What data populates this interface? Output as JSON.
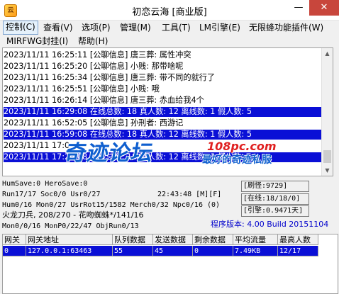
{
  "window": {
    "title": "初恋云海 [商业版]",
    "minimize": "—",
    "close": "✕"
  },
  "menu": {
    "row1": [
      "控制(C)",
      "查看(V)",
      "选项(P)",
      "管理(M)",
      "工具(T)",
      "LM引擎(E)",
      "无限蜂功能插件(W)"
    ],
    "row2": [
      "MIRFWG封挂(I)",
      "帮助(H)"
    ]
  },
  "log": [
    {
      "text": "2023/11/11 16:25:11 [公聊信息] 唐三葬: 属性冲突",
      "selected": false
    },
    {
      "text": "2023/11/11 16:25:20 [公聊信息] 小贱: 那带啥呢",
      "selected": false
    },
    {
      "text": "2023/11/11 16:25:34 [公聊信息] 唐三葬: 带不同的就行了",
      "selected": false
    },
    {
      "text": "2023/11/11 16:25:51 [公聊信息] 小贱: 哦",
      "selected": false
    },
    {
      "text": "2023/11/11 16:26:14 [公聊信息] 唐三葬: 赤血给我4个",
      "selected": false
    },
    {
      "text": "2023/11/11 16:29:08 在线总数: 18 真人数: 12 离线数: 1 假人数: 5",
      "selected": true
    },
    {
      "text": "2023/11/11 16:52:05 [公聊信息] 孙刑者: 西游记",
      "selected": false
    },
    {
      "text": "2023/11/11 16:59:08 在线总数: 18 真人数: 12 离线数: 1 假人数: 5",
      "selected": true
    },
    {
      "text": "2023/11/11 17:0",
      "selected": false
    },
    {
      "text": "2023/11/11 17:29:08 在线总数: 18 真人数: 12 离线数: 1 假人数: 5",
      "selected": true
    }
  ],
  "watermark": {
    "main": "奇迹论坛",
    "url": "108pc.com",
    "tag": "最好的奇迹私服"
  },
  "status": {
    "line1": "HumSave:0 HeroSave:0",
    "line2": "Run17/17 Soc0/0 Usr0/27",
    "clock": "22:43:48 [M][F]",
    "line3": "Hum0/16 Mon0/27 UsrRot15/1582 Merch0/32 Npc0/16 (0)",
    "line4": "火龙刀兵, 208/270 - 花吻蜘蛛*/141/16",
    "line5": "Mon0/0/16 MonP0/22/47 ObjRun0/13",
    "refresh": "[刷怪:9729]",
    "online": "[在线:18/18/0]",
    "engine": "[引擎:0.9471天]",
    "version": "程序版本: 4.00 Build 20151104"
  },
  "grid": {
    "headers": [
      "网关",
      "网关地址",
      "队列数据",
      "发送数据",
      "剩余数据",
      "平均流量",
      "最高人数"
    ],
    "rows": [
      [
        "0",
        "127.0.0.1:63463",
        "55",
        "45",
        "0",
        "7.49KB",
        "12/17"
      ]
    ]
  }
}
